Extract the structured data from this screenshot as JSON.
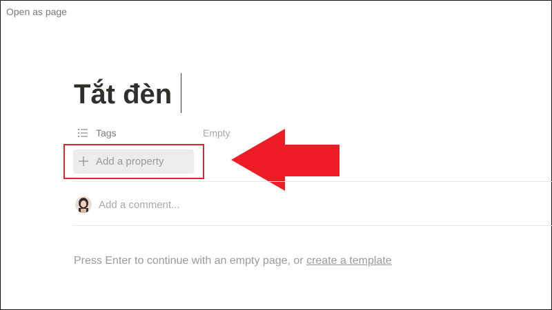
{
  "header": {
    "open_as_page": "Open as page"
  },
  "page": {
    "title": "Tắt đèn"
  },
  "properties": [
    {
      "icon": "list-icon",
      "name": "Tags",
      "value": "Empty"
    }
  ],
  "add_property": {
    "icon": "plus-icon",
    "label": "Add a property"
  },
  "comment": {
    "placeholder": "Add a comment..."
  },
  "hint": {
    "text": "Press Enter to continue with an empty page, or ",
    "link": "create a template"
  },
  "annotation": {
    "highlight_color": "#d8262e",
    "arrow_color": "#ee1c25"
  }
}
